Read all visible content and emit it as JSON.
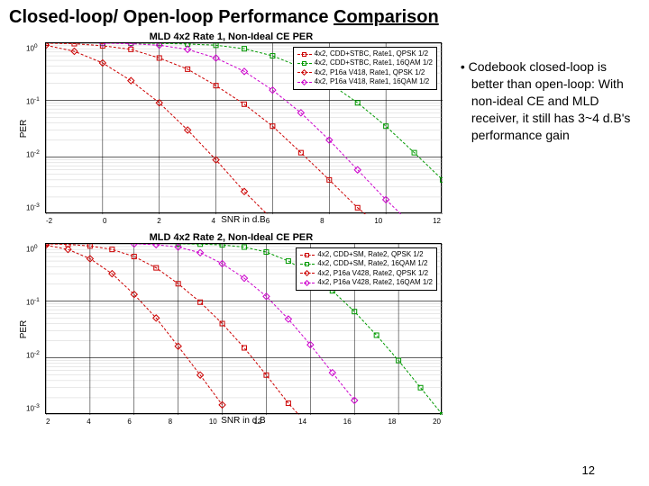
{
  "title_prefix": "Closed-loop/ Open-loop Performance ",
  "title_underlined": "Comparison",
  "side_text": "Codebook closed-loop is better than open-loop: With non-ideal CE and MLD receiver, it still has 3~4 d.B's performance gain",
  "page_number": "12",
  "chart_data": [
    {
      "type": "line",
      "title": "MLD 4x2 Rate 1, Non-Ideal CE PER",
      "xlabel": "SNR in d.B",
      "ylabel": "PER",
      "xlim": [
        -2,
        12
      ],
      "ylim_log": [
        -3,
        0
      ],
      "x_ticks": [
        "-2",
        "0",
        "2",
        "4",
        "6",
        "8",
        "10",
        "12"
      ],
      "y_ticks": [
        "10^0",
        "10^-1",
        "10^-2",
        "10^-3"
      ],
      "series": [
        {
          "name": "4x2, CDD+STBC, Rate1, QPSK 1/2",
          "color": "#cc0000",
          "marker": "square",
          "x": [
            -2,
            -1,
            0,
            1,
            2,
            3,
            4,
            5,
            6,
            7,
            8,
            9,
            10
          ],
          "y": [
            1.0,
            0.98,
            0.9,
            0.78,
            0.55,
            0.35,
            0.18,
            0.085,
            0.035,
            0.012,
            0.004,
            0.0013,
            0.0005
          ]
        },
        {
          "name": "4x2, CDD+STBC, Rate1, 16QAM 1/2",
          "color": "#009900",
          "marker": "square",
          "x": [
            0,
            1,
            2,
            3,
            4,
            5,
            6,
            7,
            8,
            9,
            10,
            11,
            12
          ],
          "y": [
            1.0,
            1.0,
            0.99,
            0.97,
            0.92,
            0.8,
            0.6,
            0.38,
            0.2,
            0.09,
            0.035,
            0.012,
            0.004
          ]
        },
        {
          "name": "4x2, P16a V418, Rate1, QPSK 1/2",
          "color": "#cc0000",
          "marker": "diamond",
          "x": [
            -2,
            -1,
            0,
            1,
            2,
            3,
            4,
            5,
            6
          ],
          "y": [
            0.92,
            0.72,
            0.45,
            0.22,
            0.09,
            0.03,
            0.009,
            0.0025,
            0.0008
          ]
        },
        {
          "name": "4x2, P16a V418, Rate1, 16QAM 1/2",
          "color": "#cc00cc",
          "marker": "diamond",
          "x": [
            0,
            1,
            2,
            3,
            4,
            5,
            6,
            7,
            8,
            9,
            10,
            11
          ],
          "y": [
            1.0,
            0.98,
            0.92,
            0.78,
            0.55,
            0.32,
            0.15,
            0.06,
            0.02,
            0.006,
            0.0018,
            0.0006
          ]
        }
      ]
    },
    {
      "type": "line",
      "title": "MLD 4x2 Rate 2, Non-Ideal CE PER",
      "xlabel": "SNR in d.B",
      "ylabel": "PER",
      "xlim": [
        2,
        20
      ],
      "ylim_log": [
        -3,
        0
      ],
      "x_ticks": [
        "2",
        "4",
        "6",
        "8",
        "10",
        "12",
        "14",
        "16",
        "18",
        "20"
      ],
      "y_ticks": [
        "10^0",
        "10^-1",
        "10^-2",
        "10^-3"
      ],
      "series": [
        {
          "name": "4x2, CDD+SM, Rate2, QPSK 1/2",
          "color": "#cc0000",
          "marker": "square",
          "x": [
            2,
            3,
            4,
            5,
            6,
            7,
            8,
            9,
            10,
            11,
            12,
            13,
            14
          ],
          "y": [
            1.0,
            0.98,
            0.92,
            0.8,
            0.6,
            0.38,
            0.2,
            0.095,
            0.04,
            0.015,
            0.005,
            0.0016,
            0.0006
          ]
        },
        {
          "name": "4x2, CDD+SM, Rate2, 16QAM 1/2",
          "color": "#009900",
          "marker": "square",
          "x": [
            8,
            9,
            10,
            11,
            12,
            13,
            14,
            15,
            16,
            17,
            18,
            19,
            20
          ],
          "y": [
            1.0,
            0.99,
            0.96,
            0.88,
            0.72,
            0.5,
            0.3,
            0.15,
            0.065,
            0.025,
            0.009,
            0.003,
            0.001
          ]
        },
        {
          "name": "4x2, P16a V428, Rate2, QPSK 1/2",
          "color": "#cc0000",
          "marker": "diamond",
          "x": [
            2,
            3,
            4,
            5,
            6,
            7,
            8,
            9,
            10
          ],
          "y": [
            0.95,
            0.8,
            0.55,
            0.3,
            0.13,
            0.05,
            0.016,
            0.005,
            0.0015
          ]
        },
        {
          "name": "4x2, P16a V428, Rate2, 16QAM 1/2",
          "color": "#cc00cc",
          "marker": "diamond",
          "x": [
            6,
            7,
            8,
            9,
            10,
            11,
            12,
            13,
            14,
            15,
            16
          ],
          "y": [
            1.0,
            0.97,
            0.88,
            0.7,
            0.45,
            0.25,
            0.12,
            0.048,
            0.017,
            0.0055,
            0.0018
          ]
        }
      ]
    }
  ]
}
